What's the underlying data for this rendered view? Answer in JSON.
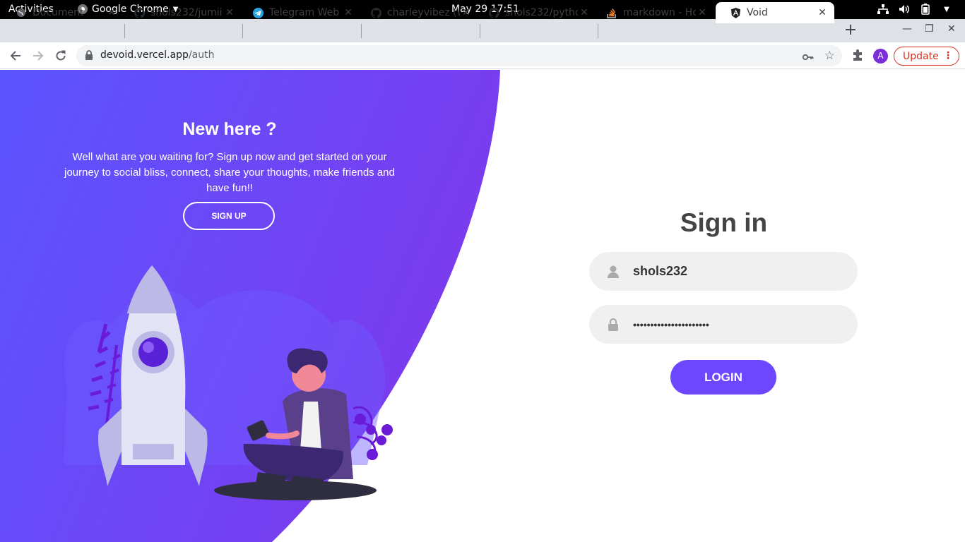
{
  "system_bar": {
    "activities": "Activities",
    "app_name": "Google Chrome",
    "clock": "May 29  17:51"
  },
  "tabs": [
    {
      "title": "Document",
      "icon": "globe-icon"
    },
    {
      "title": "shols232/jumii",
      "icon": "github-icon"
    },
    {
      "title": "Telegram Web",
      "icon": "telegram-icon"
    },
    {
      "title": "charleyvibez (W",
      "icon": "github-icon"
    },
    {
      "title": "shols232/pytho",
      "icon": "github-icon"
    },
    {
      "title": "markdown - Ho",
      "icon": "stackoverflow-icon"
    },
    {
      "title": "Void",
      "icon": "angular-icon",
      "active": true
    }
  ],
  "omnibox": {
    "domain": "devoid.vercel.app",
    "path": "/auth"
  },
  "toolbar": {
    "avatar_letter": "A",
    "update_label": "Update"
  },
  "hero": {
    "title": "New here ?",
    "text": "Well what are you waiting for? Sign up now and get started on your journey to social bliss, connect, share your thoughts, make friends and have fun!!",
    "signup_label": "SIGN UP"
  },
  "signin": {
    "title": "Sign in",
    "username": "shols232",
    "password": "••••••••••••••••••••••",
    "login_label": "LOGIN"
  },
  "colors": {
    "accent": "#6c47ff",
    "panel_gradient_start": "#5b55ff",
    "panel_gradient_end": "#7c3aed"
  }
}
